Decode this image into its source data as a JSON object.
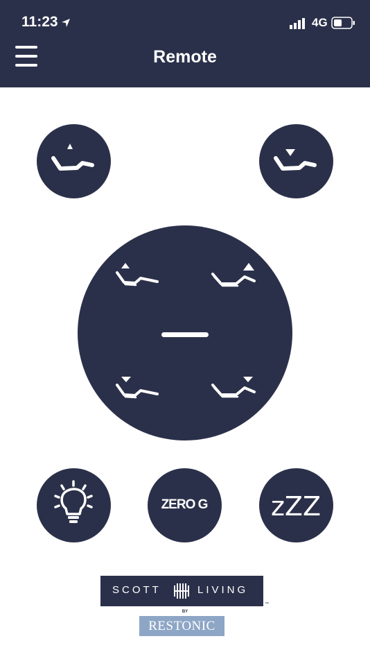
{
  "status_bar": {
    "time": "11:23",
    "network": "4G",
    "icons": [
      "location-arrow-icon",
      "cellular-signal-icon",
      "battery-icon"
    ]
  },
  "header": {
    "title": "Remote",
    "menu_icon": "hamburger-menu-icon"
  },
  "controls": {
    "head_up_icon": "recliner-raise-icon",
    "head_down_icon": "recliner-lower-icon",
    "pad": {
      "top_left_icon": "head-up-icon",
      "top_right_icon": "foot-up-icon",
      "center_icon": "flat-icon",
      "bottom_left_icon": "head-down-icon",
      "bottom_right_icon": "foot-down-icon"
    },
    "light_icon": "lightbulb-icon",
    "zero_g_label": "ZERO G",
    "sleep_label": "zZZ"
  },
  "branding": {
    "brand_left": "SCOTT",
    "brand_right": "LIVING",
    "by": "BY",
    "maker": "RESTONIC",
    "tm": "™"
  },
  "colors": {
    "primary": "#2b304a",
    "restonic": "#8ea6c6",
    "background": "#ffffff",
    "foreground": "#ffffff"
  }
}
